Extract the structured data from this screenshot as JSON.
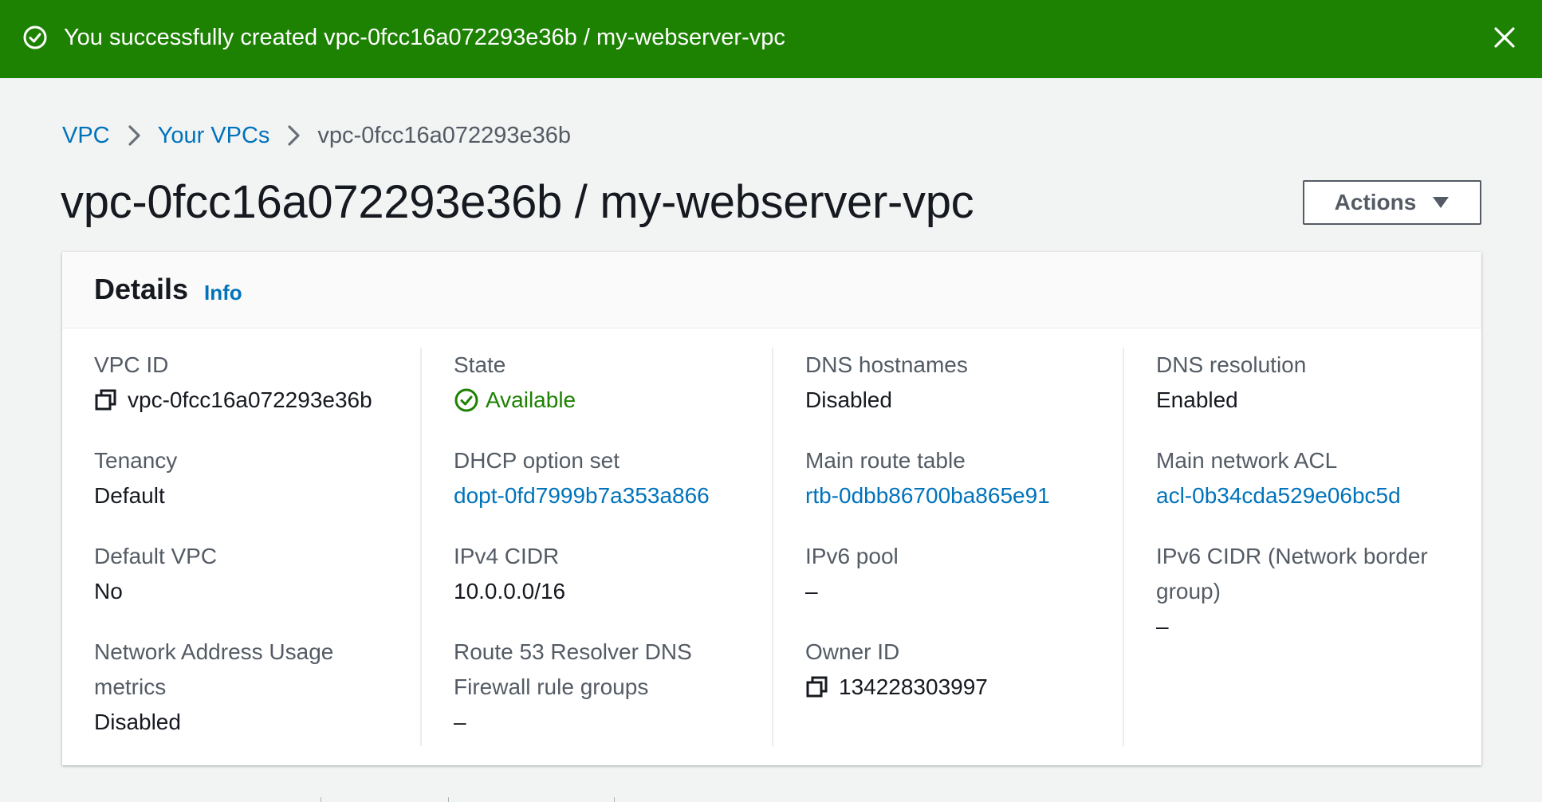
{
  "flash": {
    "message": "You successfully created vpc-0fcc16a072293e36b / my-webserver-vpc",
    "status_icon": "check-circle-icon",
    "close_icon": "close-icon",
    "color": "#1d8102"
  },
  "breadcrumb": {
    "items": [
      "VPC",
      "Your VPCs"
    ],
    "current": "vpc-0fcc16a072293e36b"
  },
  "page": {
    "title": "vpc-0fcc16a072293e36b / my-webserver-vpc",
    "actions_label": "Actions"
  },
  "details": {
    "title": "Details",
    "info_label": "Info",
    "columns": [
      [
        {
          "label": "VPC ID",
          "value": "vpc-0fcc16a072293e36b",
          "icon": "copy-icon"
        },
        {
          "label": "Tenancy",
          "value": "Default"
        },
        {
          "label": "Default VPC",
          "value": "No"
        },
        {
          "label_lines": [
            "Network Address Usage",
            "metrics"
          ],
          "value": "Disabled"
        }
      ],
      [
        {
          "label": "State",
          "value": "Available",
          "icon": "check-circle-icon",
          "status_color": "#1d8102"
        },
        {
          "label": "DHCP option set",
          "value": "dopt-0fd7999b7a353a866",
          "link": true
        },
        {
          "label": "IPv4 CIDR",
          "value": "10.0.0.0/16"
        },
        {
          "label_lines": [
            "Route 53 Resolver DNS",
            "Firewall rule groups"
          ],
          "value": "–"
        }
      ],
      [
        {
          "label": "DNS hostnames",
          "value": "Disabled"
        },
        {
          "label": "Main route table",
          "value": "rtb-0dbb86700ba865e91",
          "link": true
        },
        {
          "label": "IPv6 pool",
          "value": "–"
        },
        {
          "label": "Owner ID",
          "value": "134228303997",
          "icon": "copy-icon"
        }
      ],
      [
        {
          "label": "DNS resolution",
          "value": "Enabled"
        },
        {
          "label": "Main network ACL",
          "value": "acl-0b34cda529e06bc5d",
          "link": true
        },
        {
          "label_lines": [
            "IPv6 CIDR (Network border",
            "group)"
          ],
          "value": "–"
        }
      ]
    ]
  },
  "colors": {
    "link": "#0073bb",
    "success": "#1d8102",
    "label": "#545b64",
    "text": "#16191f"
  }
}
